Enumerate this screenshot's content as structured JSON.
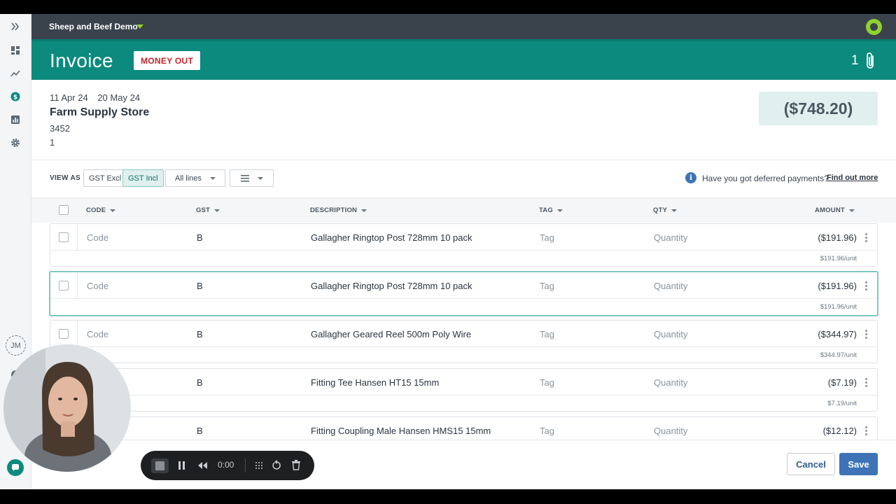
{
  "app": {
    "org_name": "Sheep and Beef Demo",
    "page_title": "Invoice",
    "badge": "MONEY OUT",
    "attachments_count": "1",
    "accent_color": "#0b8a7d",
    "topbar_color": "#3a434c"
  },
  "sidebar": {
    "items": [
      {
        "icon": "expand-icon"
      },
      {
        "icon": "dashboard-icon"
      },
      {
        "icon": "trends-icon"
      },
      {
        "icon": "money-icon",
        "active": true
      },
      {
        "icon": "reports-icon"
      },
      {
        "icon": "settings-icon"
      }
    ],
    "user_initials": "JM",
    "help_icon": "question-icon",
    "chat_icon": "chat-icon"
  },
  "invoice": {
    "date": "11 Apr 24",
    "due_date": "20 May 24",
    "supplier": "Farm Supply Store",
    "reference": "3452",
    "number": "1",
    "total": "($748.20)"
  },
  "toolbar": {
    "view_as_label": "VIEW AS",
    "gst_excl": "GST Excl",
    "gst_incl": "GST Incl",
    "lines_filter": "All lines",
    "deferred_text": "Have you got deferred payments?",
    "find_out_more": "Find out more"
  },
  "table": {
    "headers": {
      "code": "CODE",
      "gst": "GST",
      "description": "DESCRIPTION",
      "tag": "TAG",
      "qty": "QTY",
      "amount": "AMOUNT"
    },
    "placeholders": {
      "code": "Code",
      "tag": "Tag",
      "qty": "Quantity"
    },
    "rows": [
      {
        "gst": "B",
        "description": "Gallagher Ringtop Post 728mm 10 pack",
        "amount": "($191.96)",
        "unit": "$191.96/unit"
      },
      {
        "gst": "B",
        "description": "Gallagher Ringtop Post 728mm 10 pack",
        "amount": "($191.96)",
        "unit": "$191.96/unit"
      },
      {
        "gst": "B",
        "description": "Gallagher Geared Reel 500m Poly Wire",
        "amount": "($344.97)",
        "unit": "$344.97/unit"
      },
      {
        "gst": "B",
        "description": "Fitting Tee Hansen HT15 15mm",
        "amount": "($7.19)",
        "unit": "$7.19/unit"
      },
      {
        "gst": "B",
        "description": "Fitting Coupling Male Hansen HMS15 15mm",
        "amount": "($12.12)",
        "unit": ""
      }
    ]
  },
  "footer": {
    "cancel": "Cancel",
    "save": "Save"
  },
  "recorder": {
    "time": "0:00"
  }
}
